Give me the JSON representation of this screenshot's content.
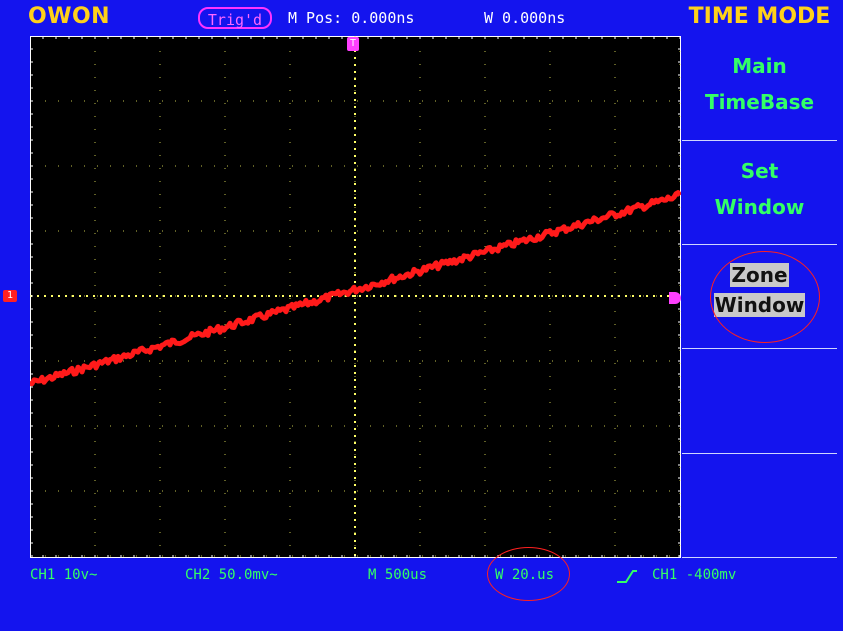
{
  "header": {
    "brand": "OWON",
    "trigger_status": "Trig'd",
    "main_position": "M Pos: 0.000ns",
    "window_position": "W 0.000ns",
    "mode_title": "TIME MODE"
  },
  "menu": {
    "items": [
      {
        "line1": "Main",
        "line2": "TimeBase",
        "selected": false
      },
      {
        "line1": "Set",
        "line2": "Window",
        "selected": false
      },
      {
        "line1": "Zone",
        "line2": "Window",
        "selected": true
      },
      {
        "line1": "",
        "line2": "",
        "selected": false
      },
      {
        "line1": "",
        "line2": "",
        "selected": false
      }
    ]
  },
  "markers": {
    "trigger_marker": "T",
    "channel_marker": "1"
  },
  "status": {
    "ch1": "CH1 10v~",
    "ch2": "CH2 50.0mv~",
    "main_timebase": "M 500us",
    "window_timebase": "W 20.us",
    "trigger": "CH1 -400mv"
  },
  "waveform": {
    "channel": "CH1",
    "color": "#ff1a1a",
    "shape": "ramp",
    "start_level_div": -1.35,
    "end_level_div": 1.55
  },
  "colors": {
    "background": "#1414ee",
    "grid": "#ffff66",
    "brand": "#ffd11a",
    "menu_text": "#33ff66",
    "status_text": "#33ff66",
    "trigger_badge": "#ff33ff",
    "annotation": "#ff2020"
  }
}
